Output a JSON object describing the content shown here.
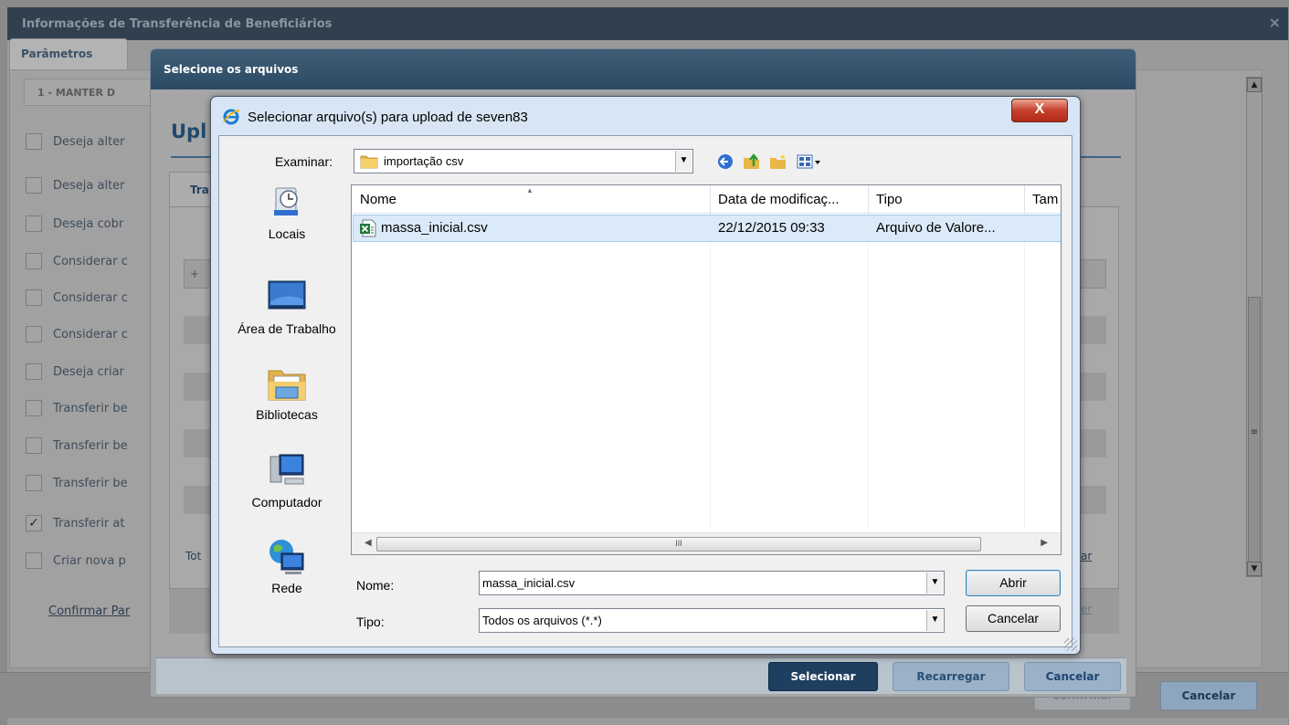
{
  "app": {
    "title": "Informações de Transferência de Beneficiários",
    "close_glyph": "×",
    "tab_label": "Parâmetros",
    "select_value": "1 - MANTER D",
    "checkbox_rows": [
      {
        "label": "Deseja alter",
        "checked": false
      },
      {
        "label": "Deseja alter",
        "checked": false
      },
      {
        "label": "Deseja cobr",
        "checked": false
      },
      {
        "label": "Considerar c",
        "checked": false
      },
      {
        "label": "Considerar c",
        "checked": false
      },
      {
        "label": "Considerar c",
        "checked": false
      },
      {
        "label": "Deseja criar",
        "checked": false
      },
      {
        "label": "Transferir be",
        "checked": false
      },
      {
        "label": "Transferir be",
        "checked": false
      },
      {
        "label": "Transferir be",
        "checked": false
      },
      {
        "label": "Transferir at",
        "checked": true
      },
      {
        "label": "Criar nova p",
        "checked": false
      }
    ],
    "confirm_link": "Confirmar Par",
    "buttons": {
      "confirm": "Confirmar",
      "cancel": "Cancelar"
    }
  },
  "modal": {
    "title": "Selecione os arquivos",
    "heading": "Upl",
    "tab_label": "Tra",
    "grid_add": "+",
    "total_label": "Tot",
    "right_link_1": "ar",
    "right_link_2": "er",
    "buttons": {
      "select": "Selecionar",
      "reload": "Recarregar",
      "cancel": "Cancelar"
    }
  },
  "dialog": {
    "title": "Selecionar arquivo(s) para upload de seven83",
    "close_glyph": "X",
    "look_in_label": "Examinar:",
    "look_in_value": "importação csv",
    "places": [
      {
        "label": "Locais",
        "icon": "recent-places-icon"
      },
      {
        "label": "Área de Trabalho",
        "icon": "desktop-icon"
      },
      {
        "label": "Bibliotecas",
        "icon": "libraries-icon"
      },
      {
        "label": "Computador",
        "icon": "computer-icon"
      },
      {
        "label": "Rede",
        "icon": "network-icon"
      }
    ],
    "columns": [
      "Nome",
      "Data de modificaç...",
      "Tipo",
      "Tam"
    ],
    "files": [
      {
        "name": "massa_inicial.csv",
        "modified": "22/12/2015 09:33",
        "type": "Arquivo de Valore...",
        "icon": "excel-csv-icon"
      }
    ],
    "scroll_grip": "III",
    "filename_label": "Nome:",
    "filename_value": "massa_inicial.csv",
    "filetype_label": "Tipo:",
    "filetype_value": "Todos os arquivos (*.*)",
    "open_button": "Abrir",
    "cancel_button": "Cancelar"
  }
}
